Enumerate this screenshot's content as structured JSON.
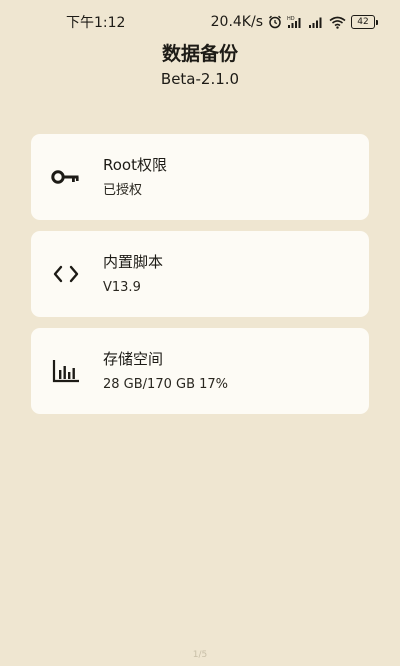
{
  "status_bar": {
    "time": "下午1:12",
    "network_speed": "20.4K/s",
    "battery_level": "42",
    "icons": [
      "alarm-icon",
      "hd-icon",
      "signal-icon",
      "signal-icon",
      "wifi-icon",
      "battery-icon"
    ]
  },
  "header": {
    "title": "数据备份",
    "version": "Beta-2.1.0"
  },
  "cards": [
    {
      "icon": "key-icon",
      "title": "Root权限",
      "subtitle": "已授权"
    },
    {
      "icon": "code-icon",
      "title": "内置脚本",
      "subtitle": "V13.9"
    },
    {
      "icon": "bar-chart-icon",
      "title": "存储空间",
      "subtitle": "28 GB/170 GB 17%"
    }
  ],
  "footer": {
    "page_indicator": "1/5"
  }
}
